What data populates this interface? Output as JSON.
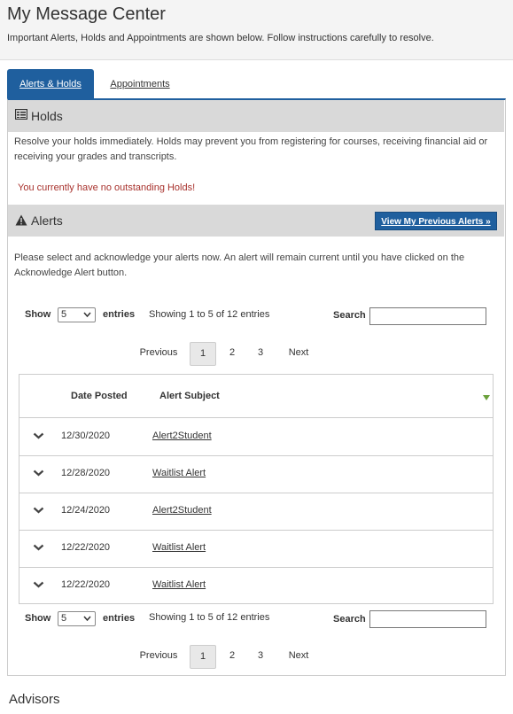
{
  "header": {
    "title": "My Message Center",
    "subtitle": "Important Alerts, Holds and Appointments are shown below. Follow instructions carefully to resolve."
  },
  "tabs": [
    {
      "label": "Alerts & Holds"
    },
    {
      "label": "Appointments"
    }
  ],
  "holds": {
    "title": "Holds",
    "description": "Resolve your holds immediately. Holds may prevent you from registering for courses, receiving financial aid or receiving your grades and transcripts.",
    "status": "You currently have no outstanding Holds!"
  },
  "alerts": {
    "title": "Alerts",
    "view_previous_label": "View My Previous Alerts »",
    "description": "Please select and acknowledge your alerts now. An alert will remain current until you have clicked on the Acknowledge Alert button.",
    "show_label": "Show",
    "entries_label": "entries",
    "page_size": "5",
    "info": "Showing 1 to 5 of 12 entries",
    "search_label": "Search",
    "search_value": "",
    "pager": {
      "previous": "Previous",
      "pages": [
        "1",
        "2",
        "3"
      ],
      "next": "Next",
      "current": "1"
    },
    "columns": {
      "date": "Date Posted",
      "subject": "Alert Subject"
    },
    "rows": [
      {
        "date": "12/30/2020",
        "subject": "Alert2Student"
      },
      {
        "date": "12/28/2020",
        "subject": "Waitlist Alert"
      },
      {
        "date": "12/24/2020",
        "subject": "Alert2Student"
      },
      {
        "date": "12/22/2020",
        "subject": "Waitlist Alert"
      },
      {
        "date": "12/22/2020",
        "subject": "Waitlist Alert"
      }
    ]
  },
  "advisors": {
    "title": "Advisors"
  },
  "colors": {
    "primary": "#1f5f9e",
    "error_text": "#a8322d",
    "section_bar": "#d9d9d9",
    "sort_indicator": "#6aa03a"
  },
  "icons": {
    "holds": "list-card-icon",
    "alerts": "warning-icon",
    "expand": "chevron-down-icon",
    "sort": "sort-desc-icon"
  }
}
